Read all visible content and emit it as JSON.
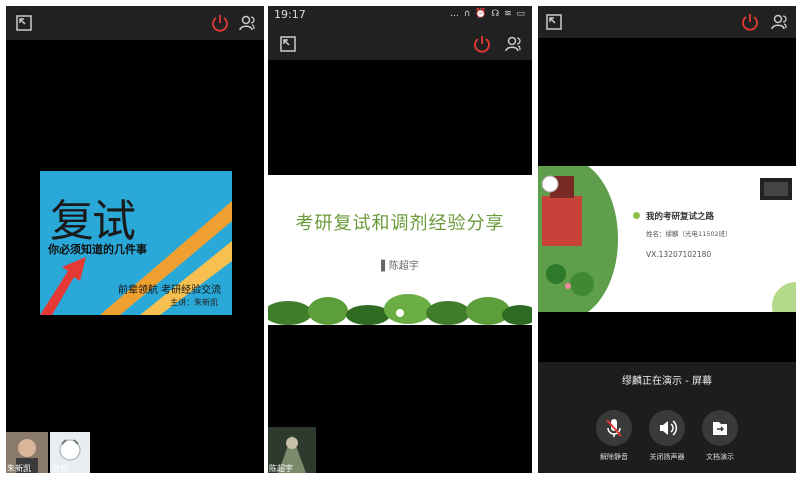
{
  "panel1": {
    "slide": {
      "big_title": "复试",
      "subtitle": "你必须知道的几件事",
      "line": "前辈领航 考研经验交流",
      "speaker": "主讲：朱新凯"
    },
    "thumbs": [
      {
        "name": "朱新凯"
      },
      {
        "name": "黄贺"
      }
    ]
  },
  "panel2": {
    "status": {
      "time": "19:17",
      "icons": "… ∩ ⏰ ☊ ≋ ▭"
    },
    "slide": {
      "title": "考研复试和调剂经验分享",
      "author": "▌陈超宇"
    },
    "thumb": {
      "name": "陈超宇"
    }
  },
  "panel3": {
    "slide": {
      "title": "我的考研复试之路",
      "name": "姓名：缪麟（光电11502班）",
      "vx": "VX.13207102180"
    },
    "presenting": "缪麟正在演示 - 屏幕",
    "controls": [
      {
        "label": "解除静音"
      },
      {
        "label": "关闭扬声器"
      },
      {
        "label": "文档演示"
      }
    ]
  },
  "colors": {
    "hangup": "#e53935",
    "slide1_bg": "#2aa8d8",
    "green_title": "#6a9a3a"
  }
}
